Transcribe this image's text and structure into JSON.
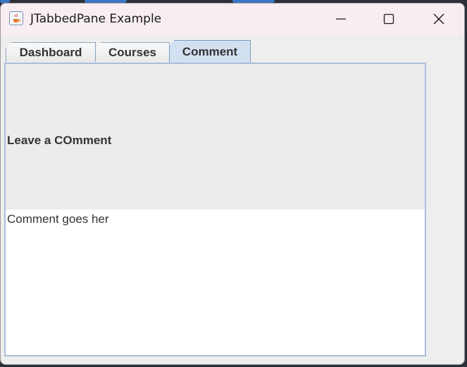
{
  "window": {
    "title": "JTabbedPane Example",
    "icon": "java-coffee-icon"
  },
  "window_controls": {
    "minimize_icon": "minimize-icon",
    "maximize_icon": "maximize-icon",
    "close_icon": "close-icon"
  },
  "tabs": [
    {
      "label": "Dashboard",
      "selected": false
    },
    {
      "label": "Courses",
      "selected": false
    },
    {
      "label": "Comment",
      "selected": true
    }
  ],
  "comment_panel": {
    "heading": "Leave a COmment",
    "text_value": "Comment goes her"
  },
  "colors": {
    "active_tab": "#d2e0f2",
    "tab_border": "#8da4c0",
    "titlebar": "#f8eef2"
  }
}
